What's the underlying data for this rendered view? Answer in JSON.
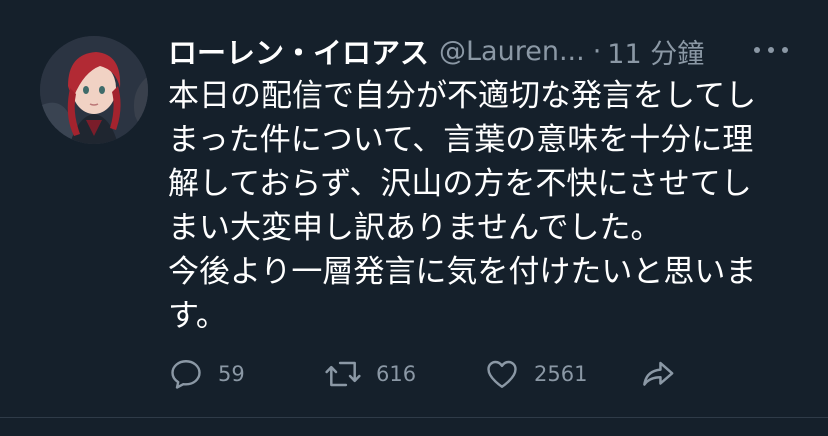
{
  "tweet": {
    "display_name": "ローレン・イロアス",
    "handle": "@Lauren...",
    "separator": "·",
    "time": "11 分鐘",
    "text_lines": [
      "本日の配信で自分が不適切な発言をしてし",
      "まった件について、言葉の意味を十分に理",
      "解しておらず、沢山の方を不快にさせてし",
      "まい大変申し訳ありませんでした。",
      "今後より一層発言に気を付けたいと思いま",
      "す。"
    ],
    "actions": {
      "reply_count": "59",
      "retweet_count": "616",
      "like_count": "2561"
    },
    "icons": [
      "reply-icon",
      "retweet-icon",
      "like-icon",
      "share-icon",
      "more-icon"
    ]
  },
  "colors": {
    "background": "#15202b",
    "text": "#ffffff",
    "secondary": "#8b98a5"
  }
}
